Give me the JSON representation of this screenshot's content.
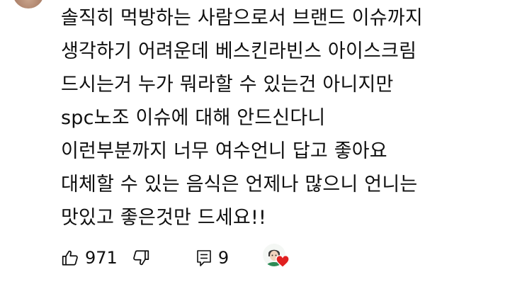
{
  "comment": {
    "lines": [
      "솔직히 먹방하는 사람으로서 브랜드 이슈까지",
      "생각하기 어려운데 베스킨라빈스 아이스크림",
      "드시는거 누가 뭐라할 수 있는건 아니지만",
      "spc노조 이슈에 대해 안드신다니",
      "이런부분까지 너무 여수언니 답고 좋아요",
      "대체할 수 있는 음식은 언제나 많으니 언니는",
      "맛있고 좋은것만 드세요!!"
    ]
  },
  "actions": {
    "like_count": "971",
    "reply_count": "9"
  },
  "icons": {
    "like": "thumbs-up-icon",
    "dislike": "thumbs-down-icon",
    "reply": "reply-icon",
    "heart": "heart-icon"
  },
  "colors": {
    "text": "#0f0f0f",
    "icon": "#0f0f0f",
    "heart": "#e02020"
  }
}
